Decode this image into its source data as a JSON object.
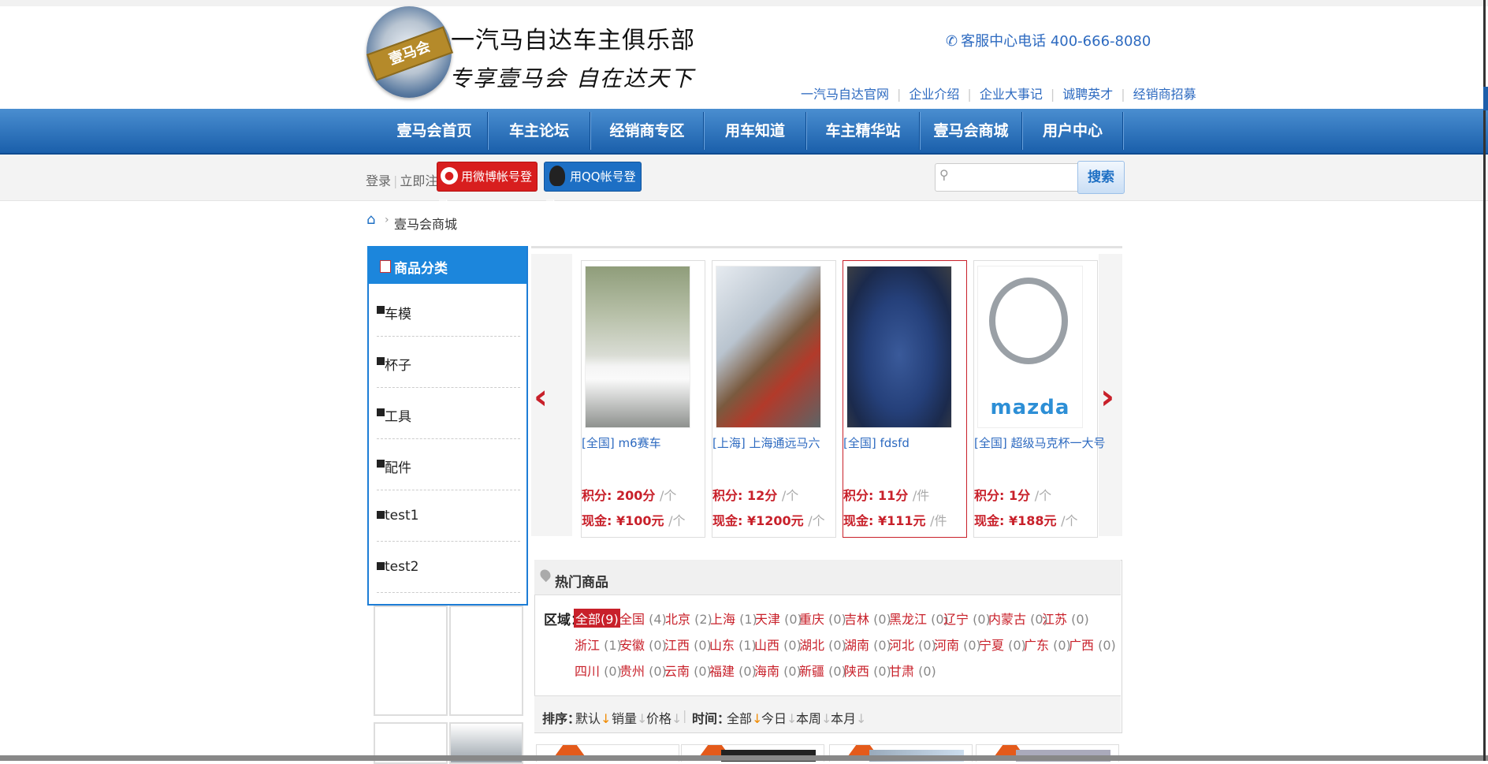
{
  "header": {
    "logo_text": "壹马会",
    "site_title": "一汽马自达车主俱乐部",
    "slogan": "专享壹马会  自在达天下",
    "phone": "客服中心电话  400-666-8080",
    "links": [
      "一汽马自达官网",
      "企业介绍",
      "企业大事记",
      "诚聘英才",
      "经销商招募"
    ]
  },
  "nav": [
    "壹马会首页",
    "车主论坛",
    "经销商专区",
    "用车知道",
    "车主精华站",
    "壹马会商城",
    "用户中心"
  ],
  "loginbar": {
    "login": "登录",
    "register": "立即注册",
    "weibo_label": "用微博帐号登录",
    "qq_label": "用QQ帐号登录",
    "search_placeholder": "",
    "search_button": "搜索"
  },
  "breadcrumb": {
    "current": "壹马会商城"
  },
  "categories": {
    "title": "商品分类",
    "items": [
      "车模",
      "杯子",
      "工具",
      "配件",
      "test1",
      "test2"
    ]
  },
  "products": [
    {
      "region": "[全国]",
      "name": "m6赛车",
      "points": "积分: 200分",
      "points_unit": "/个",
      "cash": "现金: ¥100元",
      "cash_unit": "/个"
    },
    {
      "region": "[上海]",
      "name": "上海通远马六",
      "points": "积分: 12分",
      "points_unit": "/个",
      "cash": "现金: ¥1200元",
      "cash_unit": "/个"
    },
    {
      "region": "[全国]",
      "name": "fdsfd",
      "points": "积分: 11分",
      "points_unit": "/件",
      "cash": "现金: ¥111元",
      "cash_unit": "/件"
    },
    {
      "region": "[全国]",
      "name": "超级马克杯一大号",
      "points": "积分: 1分",
      "points_unit": "/个",
      "cash": "现金: ¥188元",
      "cash_unit": "/个"
    }
  ],
  "hot": {
    "title": "热门商品",
    "region_label": "区域：",
    "regions": [
      {
        "name": "全部",
        "count": "(9)"
      },
      {
        "name": "全国",
        "count": "(4)"
      },
      {
        "name": "北京",
        "count": "(2)"
      },
      {
        "name": "上海",
        "count": "(1)"
      },
      {
        "name": "天津",
        "count": "(0)"
      },
      {
        "name": "重庆",
        "count": "(0)"
      },
      {
        "name": "吉林",
        "count": "(0)"
      },
      {
        "name": "黑龙江",
        "count": "(0)"
      },
      {
        "name": "辽宁",
        "count": "(0)"
      },
      {
        "name": "内蒙古",
        "count": "(0)"
      },
      {
        "name": "江苏",
        "count": "(0)"
      },
      {
        "name": "浙江",
        "count": "(1)"
      },
      {
        "name": "安徽",
        "count": "(0)"
      },
      {
        "name": "江西",
        "count": "(0)"
      },
      {
        "name": "山东",
        "count": "(1)"
      },
      {
        "name": "山西",
        "count": "(0)"
      },
      {
        "name": "湖北",
        "count": "(0)"
      },
      {
        "name": "湖南",
        "count": "(0)"
      },
      {
        "name": "河北",
        "count": "(0)"
      },
      {
        "name": "河南",
        "count": "(0)"
      },
      {
        "name": "宁夏",
        "count": "(0)"
      },
      {
        "name": "广东",
        "count": "(0)"
      },
      {
        "name": "广西",
        "count": "(0)"
      },
      {
        "name": "四川",
        "count": "(0)"
      },
      {
        "name": "贵州",
        "count": "(0)"
      },
      {
        "name": "云南",
        "count": "(0)"
      },
      {
        "name": "福建",
        "count": "(0)"
      },
      {
        "name": "海南",
        "count": "(0)"
      },
      {
        "name": "新疆",
        "count": "(0)"
      },
      {
        "name": "陕西",
        "count": "(0)"
      },
      {
        "name": "甘肃",
        "count": "(0)"
      }
    ],
    "sort_label": "排序：",
    "sort_options": [
      "默认",
      "销量",
      "价格"
    ],
    "time_label": "时间：",
    "time_options": [
      "全部",
      "今日",
      "本周",
      "本月"
    ]
  }
}
